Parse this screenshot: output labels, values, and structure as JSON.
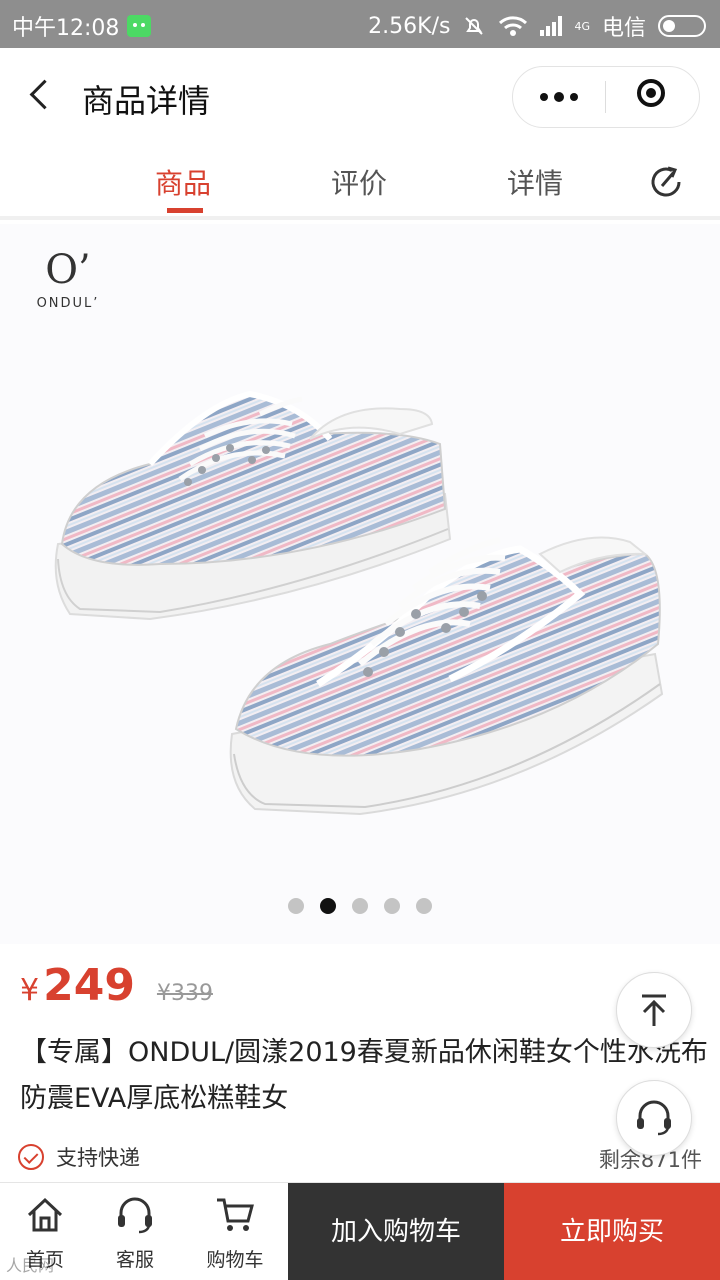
{
  "status_bar": {
    "time": "中午12:08",
    "net_speed": "2.56K/s",
    "net_type": "4G",
    "carrier": "电信"
  },
  "nav": {
    "title": "商品详情"
  },
  "tabs": [
    {
      "label": "商品",
      "active": true
    },
    {
      "label": "评价",
      "active": false
    },
    {
      "label": "详情",
      "active": false
    }
  ],
  "gallery": {
    "brand_mark": "O’",
    "brand_word": "ONDUL’",
    "slide_count": 5,
    "active_slide": 2
  },
  "product": {
    "currency": "¥",
    "price": "249",
    "original_price": "¥339",
    "title": "【专属】ONDUL/圆漾2019春夏新品休闲鞋女个性水洗布防震EVA厚底松糕鞋女",
    "feature": "支持快递",
    "stock": "剩余871件"
  },
  "bottom_bar": {
    "home_label": "首页",
    "service_label": "客服",
    "cart_label": "购物车",
    "add_to_cart": "加入购物车",
    "buy_now": "立即购买"
  },
  "watermark": "人民网",
  "colors": {
    "accent": "#d8412f",
    "dark_button": "#333333"
  }
}
